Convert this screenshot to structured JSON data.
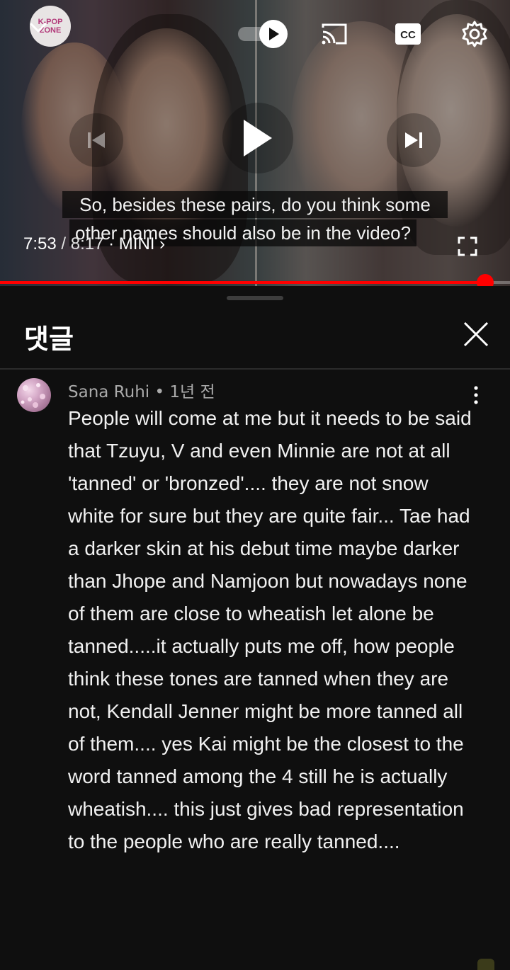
{
  "player": {
    "channel_logo_text": "K-POP ZONE",
    "caption_line1": "So, besides these pairs, do you think some",
    "caption_line2": "other names should also be in the video?",
    "time_current": "7:53",
    "time_separator": " / ",
    "time_total": "8:17",
    "mini_label": " · MINI ›",
    "progress": 0.952
  },
  "comments": {
    "title": "댓글",
    "items": [
      {
        "author": "Sana Ruhi",
        "age": "1년 전",
        "meta_separator": " • ",
        "text": "People will come at me but it needs to be said that Tzuyu, V and even Minnie are not at all 'tanned' or 'bronzed'.... they are not snow white for sure but they are quite fair... Tae had a darker skin at his debut time maybe darker than Jhope and Namjoon but nowadays none of them are close to wheatish let alone be tanned.....it actually puts me off, how people think these tones are tanned when they are not, Kendall Jenner might be more tanned all of them.... yes Kai might be the closest to the word tanned among the 4 still he is actually wheatish.... this just gives bad representation to the people who are really tanned...."
      }
    ]
  },
  "colors": {
    "accent": "#ff0000",
    "background": "#0f0f0f",
    "text": "#f1f1f1",
    "meta": "#aaaaaa"
  },
  "icons": [
    "chevron-down-icon",
    "autoplay-toggle-icon",
    "cast-icon",
    "closed-captions-icon",
    "settings-gear-icon",
    "previous-icon",
    "play-icon",
    "next-icon",
    "fullscreen-icon",
    "close-icon",
    "more-vert-icon"
  ]
}
